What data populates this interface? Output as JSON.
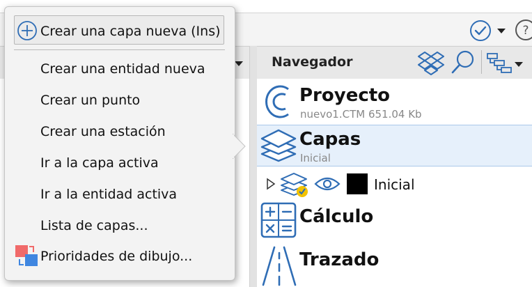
{
  "colors": {
    "accent_blue": "#2f6db5",
    "selection_bg": "#e6f0fb",
    "layer_color": "#000000",
    "active_badge": "#f2c200",
    "priority_red": "#f06a6a",
    "priority_blue": "#3f86e0"
  },
  "toolbar": {
    "check_icon": "check-circle-icon",
    "help_icon": "help-icon"
  },
  "navigator": {
    "title": "Navegador",
    "tools": [
      "dropbox-icon",
      "search-icon",
      "tree-view-icon"
    ],
    "items": {
      "project": {
        "title": "Proyecto",
        "subtitle": "nuevo1.CTM 651.04 Kb",
        "icon": "project-icon"
      },
      "layers": {
        "title": "Capas",
        "subtitle": "Inicial",
        "icon": "layers-icon",
        "selected": true
      },
      "layer_row": {
        "name": "Inicial",
        "visible": true,
        "active": true
      },
      "calculation": {
        "title": "Cálculo",
        "icon": "calculator-icon"
      },
      "route": {
        "title": "Trazado",
        "icon": "road-icon"
      }
    }
  },
  "context_menu": {
    "primary": {
      "label": "Crear una capa nueva (Ins)",
      "icon": "add-circle-icon"
    },
    "items": [
      {
        "label": "Crear una entidad nueva"
      },
      {
        "label": "Crear un punto"
      },
      {
        "label": "Crear una estación"
      },
      {
        "label": "Ir a la capa activa"
      },
      {
        "label": "Ir a la entidad activa"
      },
      {
        "label": "Lista de capas..."
      },
      {
        "label": "Prioridades de dibujo...",
        "icon": "draw-priority-icon"
      }
    ]
  }
}
